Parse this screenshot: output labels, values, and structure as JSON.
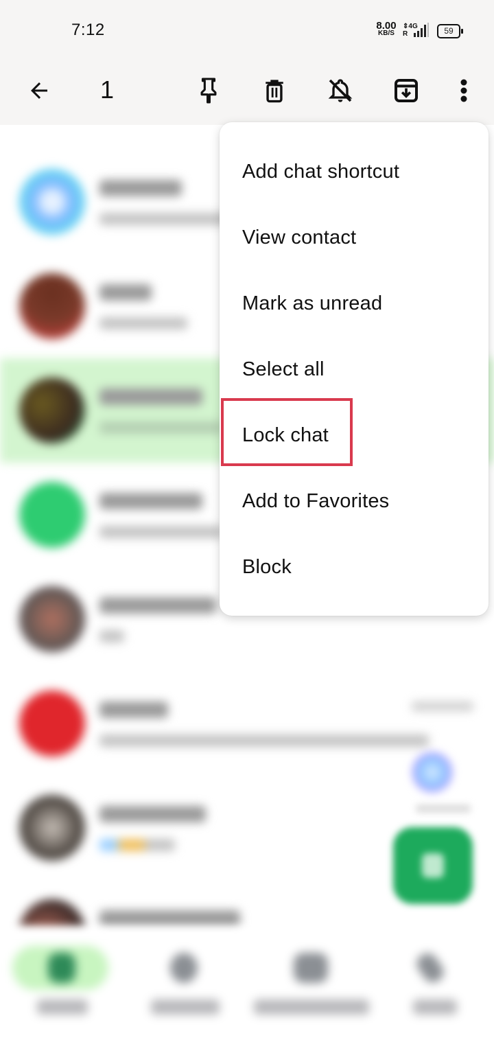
{
  "status_bar": {
    "time": "7:12",
    "net_speed_value": "8.00",
    "net_speed_unit": "KB/S",
    "network_type": "4G",
    "roaming": "R",
    "battery": "59"
  },
  "selection_toolbar": {
    "selected_count": "1",
    "icons": [
      "back-arrow-icon",
      "pin-icon",
      "delete-icon",
      "mute-icon",
      "archive-icon",
      "more-options-icon"
    ]
  },
  "overflow_menu": {
    "items": [
      {
        "label": "Add chat shortcut"
      },
      {
        "label": "View contact"
      },
      {
        "label": "Mark as unread"
      },
      {
        "label": "Select all"
      },
      {
        "label": "Lock chat",
        "highlighted": true
      },
      {
        "label": "Add to Favorites"
      },
      {
        "label": "Block"
      }
    ],
    "highlight_color": "#d93a4e"
  },
  "chat_list": {
    "note": "blurred",
    "selected_row_color": "#d3f5cf",
    "rows": [
      {
        "avatar_color": "#7fb8ff",
        "selected": false
      },
      {
        "avatar_color": "#7a3a2a",
        "selected": false
      },
      {
        "avatar_color": "#4a4a2a",
        "selected": true
      },
      {
        "avatar_color": "#2ecc71",
        "selected": false
      },
      {
        "avatar_color": "#6a5a55",
        "selected": false
      },
      {
        "avatar_color": "#e0262c",
        "selected": false
      },
      {
        "avatar_color": "#5a534d",
        "selected": false
      },
      {
        "avatar_color": "#7a4a40",
        "selected": false
      }
    ]
  },
  "bottom_nav": {
    "note": "blurred",
    "items": [
      {
        "icon": "chats-icon",
        "active": true
      },
      {
        "icon": "updates-icon",
        "active": false
      },
      {
        "icon": "communities-icon",
        "active": false
      },
      {
        "icon": "calls-icon",
        "active": false
      }
    ]
  },
  "colors": {
    "accent_green": "#1daa5c",
    "toolbar_bg": "#f6f5f4"
  }
}
